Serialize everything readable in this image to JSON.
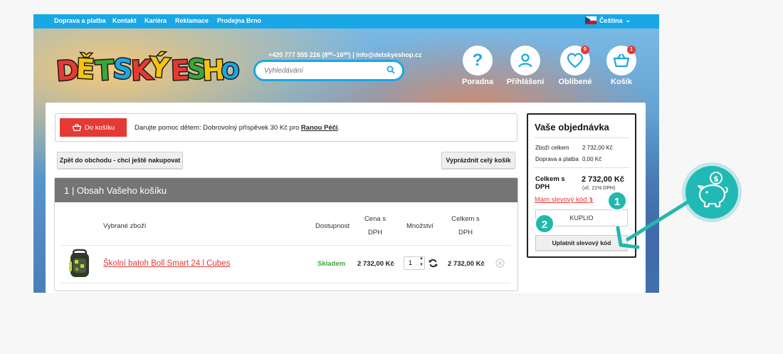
{
  "topnav": {
    "links": [
      "Doprava a platba",
      "Kontakt",
      "Kariéra",
      "Reklamace",
      "Prodejna Brno"
    ],
    "language": "Čeština"
  },
  "header": {
    "logo_text": "DĚTSKÝ ESHOP",
    "contact": "+420 777 555 226 (8⁰⁰–16⁰⁰) | info@detskyeshop.cz",
    "search_placeholder": "Vyhledávání",
    "icons": [
      {
        "name": "help-icon",
        "label": "Poradna"
      },
      {
        "name": "user-icon",
        "label": "Přihlášení"
      },
      {
        "name": "heart-icon",
        "label": "Oblíbené",
        "badge": "0"
      },
      {
        "name": "cart-icon",
        "label": "Košík",
        "badge": "1"
      }
    ]
  },
  "donation": {
    "button_label": "Do košíku",
    "text": "Darujte pomoc dětem: Dobrovolný příspěvek 30 Kč pro",
    "link": "Ranou Péči",
    "end": "."
  },
  "actions": {
    "back_label": "Zpět do obchodu - chci ještě nakupovat",
    "empty_label": "Vyprázdnit celý košík"
  },
  "cart": {
    "heading": "1 | Obsah Vašeho košíku",
    "columns": {
      "product": "Vybrané zboží",
      "availability": "Dostupnost",
      "price": "Cena s DPH",
      "quantity": "Množství",
      "total": "Celkem s DPH"
    },
    "items": [
      {
        "name": "Školní batoh Boll Smart 24 l Cubes",
        "availability": "Skladem",
        "price": "2 732,00 Kč",
        "quantity": "1",
        "total": "2 732,00 Kč"
      }
    ]
  },
  "order": {
    "title": "Vaše objednávka",
    "rows": [
      {
        "label": "Zboží celkem",
        "value": "2 732,00 Kč"
      },
      {
        "label": "Doprava a platba",
        "value": "0,00 Kč"
      }
    ],
    "total_label": "Celkem s DPH",
    "total_value": "2 732,00 Kč",
    "vat_note": "(vč. 21% DPH)",
    "discount_link": "Mám slevový kód",
    "code_value": "KUPLIO",
    "apply_label": "Uplatnit slevový kód"
  },
  "annotations": {
    "step1": "1",
    "step2": "2"
  },
  "colors": {
    "accent": "#1aa7e6",
    "red": "#e53935",
    "teal": "#22b8ac",
    "cart_head": "#757575"
  }
}
